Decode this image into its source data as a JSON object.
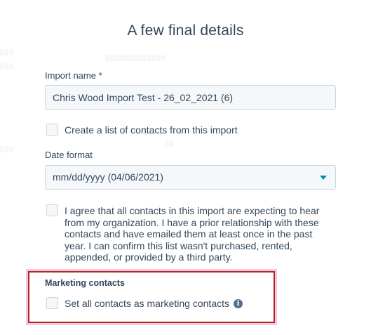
{
  "header": {
    "title": "A few final details"
  },
  "import_name": {
    "label": "Import name *",
    "value": "Chris Wood Import Test - 26_02_2021 (6)"
  },
  "create_list": {
    "label": "Create a list of contacts from this import",
    "checked": false
  },
  "date_format": {
    "label": "Date format",
    "selected": "mm/dd/yyyy (04/06/2021)"
  },
  "consent": {
    "text": "I agree that all contacts in this import are expecting to hear from my organization. I have a prior relationship with these contacts and have emailed them at least once in the past year. I can confirm this list wasn't purchased, rented, appended, or provided by a third party.",
    "checked": false
  },
  "marketing": {
    "label": "Marketing contacts",
    "checkbox_label": "Set all contacts as marketing contacts",
    "checked": false,
    "info_icon": "info-icon"
  },
  "colors": {
    "text": "#33475b",
    "input_bg": "#f5f8fa",
    "border": "#cbd6e2",
    "accent": "#0091ae",
    "highlight_border": "#b0271d",
    "highlight_glow": "#f3c6e6"
  }
}
